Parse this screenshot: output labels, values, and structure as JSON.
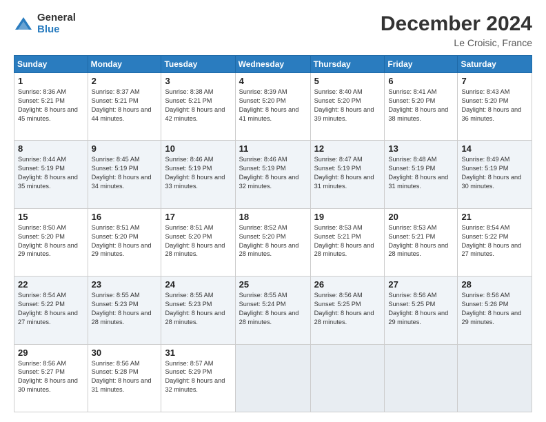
{
  "header": {
    "logo_general": "General",
    "logo_blue": "Blue",
    "month_title": "December 2024",
    "location": "Le Croisic, France"
  },
  "weekdays": [
    "Sunday",
    "Monday",
    "Tuesday",
    "Wednesday",
    "Thursday",
    "Friday",
    "Saturday"
  ],
  "weeks": [
    [
      {
        "day": "1",
        "sunrise": "Sunrise: 8:36 AM",
        "sunset": "Sunset: 5:21 PM",
        "daylight": "Daylight: 8 hours and 45 minutes."
      },
      {
        "day": "2",
        "sunrise": "Sunrise: 8:37 AM",
        "sunset": "Sunset: 5:21 PM",
        "daylight": "Daylight: 8 hours and 44 minutes."
      },
      {
        "day": "3",
        "sunrise": "Sunrise: 8:38 AM",
        "sunset": "Sunset: 5:21 PM",
        "daylight": "Daylight: 8 hours and 42 minutes."
      },
      {
        "day": "4",
        "sunrise": "Sunrise: 8:39 AM",
        "sunset": "Sunset: 5:20 PM",
        "daylight": "Daylight: 8 hours and 41 minutes."
      },
      {
        "day": "5",
        "sunrise": "Sunrise: 8:40 AM",
        "sunset": "Sunset: 5:20 PM",
        "daylight": "Daylight: 8 hours and 39 minutes."
      },
      {
        "day": "6",
        "sunrise": "Sunrise: 8:41 AM",
        "sunset": "Sunset: 5:20 PM",
        "daylight": "Daylight: 8 hours and 38 minutes."
      },
      {
        "day": "7",
        "sunrise": "Sunrise: 8:43 AM",
        "sunset": "Sunset: 5:20 PM",
        "daylight": "Daylight: 8 hours and 36 minutes."
      }
    ],
    [
      {
        "day": "8",
        "sunrise": "Sunrise: 8:44 AM",
        "sunset": "Sunset: 5:19 PM",
        "daylight": "Daylight: 8 hours and 35 minutes."
      },
      {
        "day": "9",
        "sunrise": "Sunrise: 8:45 AM",
        "sunset": "Sunset: 5:19 PM",
        "daylight": "Daylight: 8 hours and 34 minutes."
      },
      {
        "day": "10",
        "sunrise": "Sunrise: 8:46 AM",
        "sunset": "Sunset: 5:19 PM",
        "daylight": "Daylight: 8 hours and 33 minutes."
      },
      {
        "day": "11",
        "sunrise": "Sunrise: 8:46 AM",
        "sunset": "Sunset: 5:19 PM",
        "daylight": "Daylight: 8 hours and 32 minutes."
      },
      {
        "day": "12",
        "sunrise": "Sunrise: 8:47 AM",
        "sunset": "Sunset: 5:19 PM",
        "daylight": "Daylight: 8 hours and 31 minutes."
      },
      {
        "day": "13",
        "sunrise": "Sunrise: 8:48 AM",
        "sunset": "Sunset: 5:19 PM",
        "daylight": "Daylight: 8 hours and 31 minutes."
      },
      {
        "day": "14",
        "sunrise": "Sunrise: 8:49 AM",
        "sunset": "Sunset: 5:19 PM",
        "daylight": "Daylight: 8 hours and 30 minutes."
      }
    ],
    [
      {
        "day": "15",
        "sunrise": "Sunrise: 8:50 AM",
        "sunset": "Sunset: 5:20 PM",
        "daylight": "Daylight: 8 hours and 29 minutes."
      },
      {
        "day": "16",
        "sunrise": "Sunrise: 8:51 AM",
        "sunset": "Sunset: 5:20 PM",
        "daylight": "Daylight: 8 hours and 29 minutes."
      },
      {
        "day": "17",
        "sunrise": "Sunrise: 8:51 AM",
        "sunset": "Sunset: 5:20 PM",
        "daylight": "Daylight: 8 hours and 28 minutes."
      },
      {
        "day": "18",
        "sunrise": "Sunrise: 8:52 AM",
        "sunset": "Sunset: 5:20 PM",
        "daylight": "Daylight: 8 hours and 28 minutes."
      },
      {
        "day": "19",
        "sunrise": "Sunrise: 8:53 AM",
        "sunset": "Sunset: 5:21 PM",
        "daylight": "Daylight: 8 hours and 28 minutes."
      },
      {
        "day": "20",
        "sunrise": "Sunrise: 8:53 AM",
        "sunset": "Sunset: 5:21 PM",
        "daylight": "Daylight: 8 hours and 28 minutes."
      },
      {
        "day": "21",
        "sunrise": "Sunrise: 8:54 AM",
        "sunset": "Sunset: 5:22 PM",
        "daylight": "Daylight: 8 hours and 27 minutes."
      }
    ],
    [
      {
        "day": "22",
        "sunrise": "Sunrise: 8:54 AM",
        "sunset": "Sunset: 5:22 PM",
        "daylight": "Daylight: 8 hours and 27 minutes."
      },
      {
        "day": "23",
        "sunrise": "Sunrise: 8:55 AM",
        "sunset": "Sunset: 5:23 PM",
        "daylight": "Daylight: 8 hours and 28 minutes."
      },
      {
        "day": "24",
        "sunrise": "Sunrise: 8:55 AM",
        "sunset": "Sunset: 5:23 PM",
        "daylight": "Daylight: 8 hours and 28 minutes."
      },
      {
        "day": "25",
        "sunrise": "Sunrise: 8:55 AM",
        "sunset": "Sunset: 5:24 PM",
        "daylight": "Daylight: 8 hours and 28 minutes."
      },
      {
        "day": "26",
        "sunrise": "Sunrise: 8:56 AM",
        "sunset": "Sunset: 5:25 PM",
        "daylight": "Daylight: 8 hours and 28 minutes."
      },
      {
        "day": "27",
        "sunrise": "Sunrise: 8:56 AM",
        "sunset": "Sunset: 5:25 PM",
        "daylight": "Daylight: 8 hours and 29 minutes."
      },
      {
        "day": "28",
        "sunrise": "Sunrise: 8:56 AM",
        "sunset": "Sunset: 5:26 PM",
        "daylight": "Daylight: 8 hours and 29 minutes."
      }
    ],
    [
      {
        "day": "29",
        "sunrise": "Sunrise: 8:56 AM",
        "sunset": "Sunset: 5:27 PM",
        "daylight": "Daylight: 8 hours and 30 minutes."
      },
      {
        "day": "30",
        "sunrise": "Sunrise: 8:56 AM",
        "sunset": "Sunset: 5:28 PM",
        "daylight": "Daylight: 8 hours and 31 minutes."
      },
      {
        "day": "31",
        "sunrise": "Sunrise: 8:57 AM",
        "sunset": "Sunset: 5:29 PM",
        "daylight": "Daylight: 8 hours and 32 minutes."
      },
      null,
      null,
      null,
      null
    ]
  ]
}
